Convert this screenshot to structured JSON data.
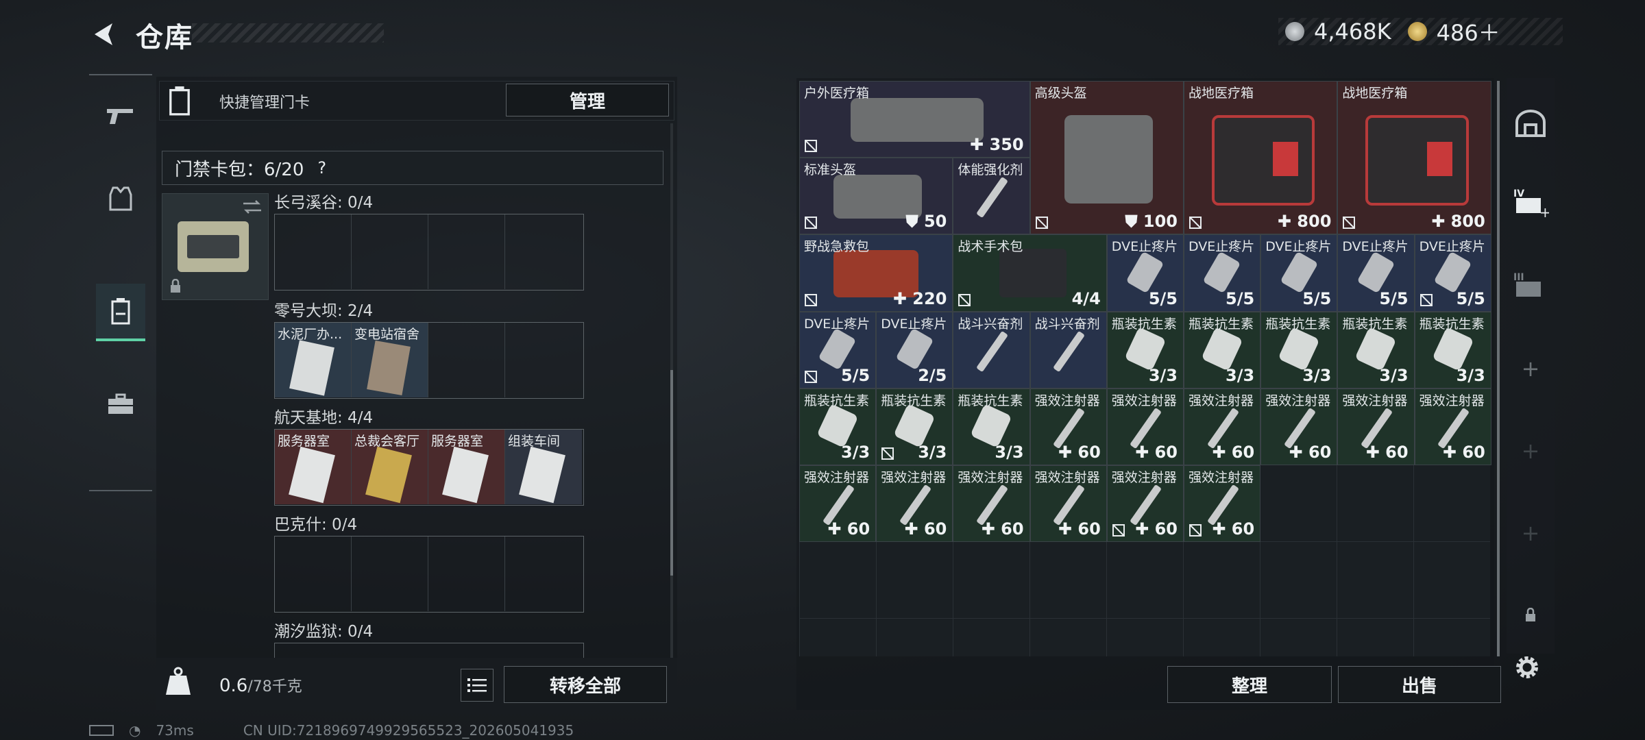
{
  "header": {
    "title": "仓库"
  },
  "currency": [
    {
      "icon": "silver-coin-icon",
      "value": "4,468K"
    },
    {
      "icon": "gold-coin-icon",
      "value": "486＋"
    }
  ],
  "left_rail": [
    "gun-icon",
    "armor-icon",
    "keycard-bag-icon",
    "briefcase-icon"
  ],
  "quick_manage": {
    "label": "快捷管理门卡",
    "button": "管理"
  },
  "card_bag": {
    "label": "门禁卡包：6/20",
    "help": "?"
  },
  "locations": [
    {
      "label": "长弓溪谷: 0/4",
      "slots": []
    },
    {
      "label": "零号大坝: 2/4",
      "slots": [
        {
          "name": "水泥厂办...",
          "color": "blue"
        },
        {
          "name": "变电站宿舍",
          "color": "blue"
        }
      ]
    },
    {
      "label": "航天基地: 4/4",
      "slots": [
        {
          "name": "服务器室",
          "color": "red"
        },
        {
          "name": "总裁会客厅",
          "color": "gold"
        },
        {
          "name": "服务器室",
          "color": "red"
        },
        {
          "name": "组装车间",
          "color": "red"
        }
      ]
    },
    {
      "label": "巴克什: 0/4",
      "slots": []
    },
    {
      "label": "潮汐监狱: 0/4",
      "slots": []
    }
  ],
  "bottom_left": {
    "weight": "0.6",
    "weight_max": "/78千克",
    "transfer_button": "转移全部"
  },
  "status": {
    "ping": "73ms",
    "uid": "CN UID:7218969749929565523_202605041935"
  },
  "storage_items": [
    {
      "name": "户外医疗箱",
      "count": "350",
      "count_icon": "plus",
      "color": "purple",
      "locked": true
    },
    {
      "name": "高级头盔",
      "count": "100",
      "count_icon": "shield",
      "color": "red",
      "locked": true
    },
    {
      "name": "战地医疗箱",
      "count": "800",
      "count_icon": "plus",
      "color": "red",
      "locked": true
    },
    {
      "name": "战地医疗箱",
      "count": "800",
      "count_icon": "plus",
      "color": "red",
      "locked": true
    },
    {
      "name": "标准头盔",
      "count": "50",
      "count_icon": "shield",
      "color": "purple",
      "locked": true
    },
    {
      "name": "体能强化剂",
      "count": "",
      "count_icon": "",
      "color": "purple",
      "locked": false
    },
    {
      "name": "野战急救包",
      "count": "220",
      "count_icon": "plus",
      "color": "navy",
      "locked": true
    },
    {
      "name": "战术手术包",
      "count": "4/4",
      "count_icon": "",
      "color": "green",
      "locked": true
    },
    {
      "name": "DVE止疼片",
      "count": "5/5",
      "count_icon": "",
      "color": "navy",
      "locked": false
    },
    {
      "name": "DVE止疼片",
      "count": "5/5",
      "count_icon": "",
      "color": "navy",
      "locked": false
    },
    {
      "name": "DVE止疼片",
      "count": "5/5",
      "count_icon": "",
      "color": "navy",
      "locked": false
    },
    {
      "name": "DVE止疼片",
      "count": "5/5",
      "count_icon": "",
      "color": "navy",
      "locked": false
    },
    {
      "name": "DVE止疼片",
      "count": "5/5",
      "count_icon": "",
      "color": "navy",
      "locked": true
    },
    {
      "name": "DVE止疼片",
      "count": "5/5",
      "count_icon": "",
      "color": "navy",
      "locked": true
    },
    {
      "name": "DVE止疼片",
      "count": "2/5",
      "count_icon": "",
      "color": "navy",
      "locked": false
    },
    {
      "name": "战斗兴奋剂",
      "count": "",
      "count_icon": "",
      "color": "navy",
      "locked": false
    },
    {
      "name": "战斗兴奋剂",
      "count": "",
      "count_icon": "",
      "color": "navy",
      "locked": false
    },
    {
      "name": "瓶装抗生素",
      "count": "3/3",
      "count_icon": "",
      "color": "green",
      "locked": false
    },
    {
      "name": "瓶装抗生素",
      "count": "3/3",
      "count_icon": "",
      "color": "green",
      "locked": false
    },
    {
      "name": "瓶装抗生素",
      "count": "3/3",
      "count_icon": "",
      "color": "green",
      "locked": false
    },
    {
      "name": "瓶装抗生素",
      "count": "3/3",
      "count_icon": "",
      "color": "green",
      "locked": false
    },
    {
      "name": "瓶装抗生素",
      "count": "3/3",
      "count_icon": "",
      "color": "green",
      "locked": false
    },
    {
      "name": "瓶装抗生素",
      "count": "3/3",
      "count_icon": "",
      "color": "green",
      "locked": false
    },
    {
      "name": "瓶装抗生素",
      "count": "3/3",
      "count_icon": "",
      "color": "green",
      "locked": true
    },
    {
      "name": "瓶装抗生素",
      "count": "3/3",
      "count_icon": "",
      "color": "green",
      "locked": false
    },
    {
      "name": "强效注射器",
      "count": "60",
      "count_icon": "plus",
      "color": "green",
      "locked": false
    },
    {
      "name": "强效注射器",
      "count": "60",
      "count_icon": "plus",
      "color": "green",
      "locked": false
    },
    {
      "name": "强效注射器",
      "count": "60",
      "count_icon": "plus",
      "color": "green",
      "locked": false
    },
    {
      "name": "强效注射器",
      "count": "60",
      "count_icon": "plus",
      "color": "green",
      "locked": false
    },
    {
      "name": "强效注射器",
      "count": "60",
      "count_icon": "plus",
      "color": "green",
      "locked": false
    },
    {
      "name": "强效注射器",
      "count": "60",
      "count_icon": "plus",
      "color": "green",
      "locked": false
    },
    {
      "name": "强效注射器",
      "count": "60",
      "count_icon": "plus",
      "color": "green",
      "locked": false
    },
    {
      "name": "强效注射器",
      "count": "60",
      "count_icon": "plus",
      "color": "green",
      "locked": false
    },
    {
      "name": "强效注射器",
      "count": "60",
      "count_icon": "plus",
      "color": "green",
      "locked": false
    },
    {
      "name": "强效注射器",
      "count": "60",
      "count_icon": "plus",
      "color": "green",
      "locked": false
    },
    {
      "name": "强效注射器",
      "count": "60",
      "count_icon": "plus",
      "color": "green",
      "locked": true
    },
    {
      "name": "强效注射器",
      "count": "60",
      "count_icon": "plus",
      "color": "green",
      "locked": true
    }
  ],
  "right_buttons": {
    "sort": "整理",
    "sell": "出售"
  },
  "right_rail": [
    "helmet-slot-icon",
    "tier-iv-case-icon",
    "tier-iii-case-icon",
    "add-icon",
    "add-icon",
    "add-icon",
    "lock-icon"
  ],
  "colors": {
    "accent": "#5fd1a6",
    "purple": "#2a2a3c",
    "red": "#3c2426",
    "green": "#1f3329",
    "navy": "#27324a"
  }
}
